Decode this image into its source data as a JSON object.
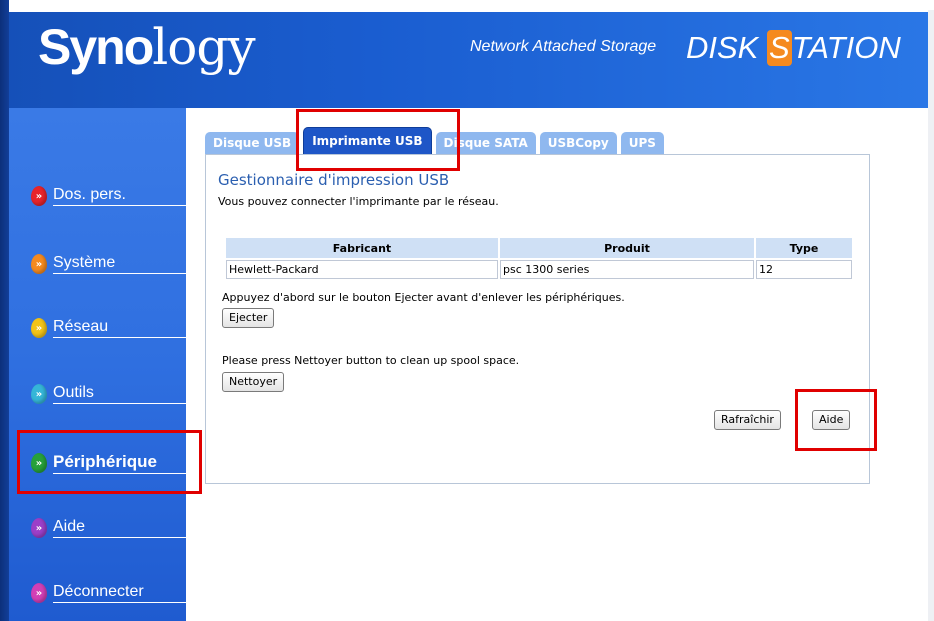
{
  "header": {
    "logo_bold": "Syno",
    "logo_light": "logy",
    "tagline": "Network Attached Storage",
    "product_part1": "DISK ",
    "product_badge": "S",
    "product_part2": "TATION"
  },
  "sidebar": {
    "items": [
      {
        "label": "Dos. pers.",
        "icon_color": "#e8242b"
      },
      {
        "label": "Système",
        "icon_color": "#f58a1f"
      },
      {
        "label": "Réseau",
        "icon_color": "#f2c318"
      },
      {
        "label": "Outils",
        "icon_color": "#35b6d8"
      },
      {
        "label": "Périphérique",
        "icon_color": "#27a13b"
      },
      {
        "label": "Aide",
        "icon_color": "#9b3fc8"
      },
      {
        "label": "Déconnecter",
        "icon_color": "#d23fb6"
      }
    ],
    "active_index": 4
  },
  "tabs": [
    {
      "label": "Disque USB"
    },
    {
      "label": "Imprimante USB"
    },
    {
      "label": "Disque SATA"
    },
    {
      "label": "USBCopy"
    },
    {
      "label": "UPS"
    }
  ],
  "panel": {
    "title": "Gestionnaire d'impression USB",
    "description": "Vous pouvez connecter l'imprimante par le réseau.",
    "table": {
      "headers": [
        "Fabricant",
        "Produit",
        "Type"
      ],
      "rows": [
        [
          "Hewlett-Packard",
          "psc 1300 series",
          "12"
        ]
      ]
    },
    "eject_note": "Appuyez d'abord sur le bouton Ejecter avant d'enlever les périphériques.",
    "eject_button": "Ejecter",
    "clean_note": "Please press Nettoyer button to clean up spool space.",
    "clean_button": "Nettoyer",
    "refresh_button": "Rafraîchir",
    "help_button": "Aide"
  },
  "colors": {
    "header_blue": "#1a5dd0",
    "sidebar_blue": "#2f6fe0",
    "active_tab": "#1e56c7",
    "annotation_red": "#e00000"
  }
}
